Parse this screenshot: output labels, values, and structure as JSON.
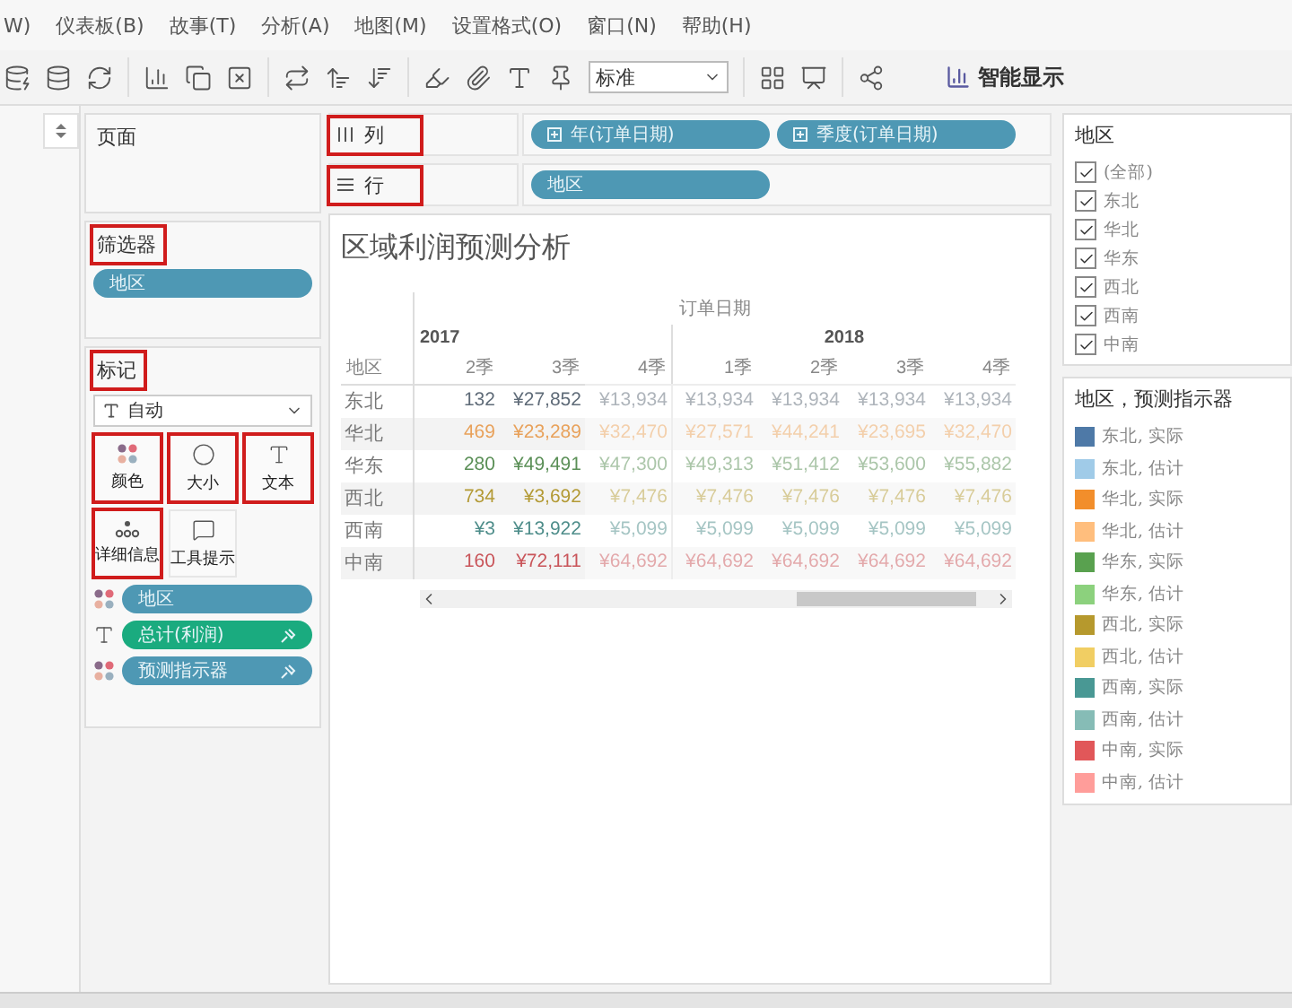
{
  "menu": [
    "W)",
    "仪表板(B)",
    "故事(T)",
    "分析(A)",
    "地图(M)",
    "设置格式(O)",
    "窗口(N)",
    "帮助(H)"
  ],
  "toolbar": {
    "select": "标准",
    "smart_button": "智能显示"
  },
  "pages": {
    "label": "页面"
  },
  "columns_shelf": {
    "label": "列",
    "highlighted": true,
    "pills": [
      "年(订单日期)",
      "季度(订单日期)"
    ]
  },
  "rows_shelf": {
    "label": "行",
    "highlighted": true,
    "pills": [
      "地区"
    ]
  },
  "filters": {
    "label": "筛选器",
    "highlighted": true,
    "pills": [
      "地区"
    ]
  },
  "marks": {
    "label": "标记",
    "highlighted": true,
    "type": "自动",
    "buttons": [
      {
        "kind": "color",
        "label": "颜色",
        "highlighted": true
      },
      {
        "kind": "size",
        "label": "大小",
        "highlighted": true
      },
      {
        "kind": "text",
        "label": "文本",
        "highlighted": true
      },
      {
        "kind": "detail",
        "label": "详细信息",
        "highlighted": true
      },
      {
        "kind": "tooltip",
        "label": "工具提示",
        "highlighted": false
      }
    ],
    "pills": [
      {
        "kind": "color",
        "label": "地区",
        "color": "#4e98b4"
      },
      {
        "kind": "text",
        "label": "总计(利润)",
        "color": "#1aab7f"
      },
      {
        "kind": "color",
        "label": "预测指示器",
        "color": "#4e98b4"
      }
    ]
  },
  "view": {
    "title": "区域利润预测分析",
    "column_header": "订单日期",
    "row_header": "地区",
    "years": [
      {
        "label": "2017",
        "quarters": [
          "2季",
          "3季",
          "4季"
        ]
      },
      {
        "label": "2018",
        "quarters": [
          "1季",
          "2季",
          "3季",
          "4季"
        ]
      }
    ],
    "rows": [
      {
        "label": "东北",
        "color": "#5f6b78",
        "cells": [
          {
            "text": "132",
            "estimate": false
          },
          {
            "text": "¥27,852",
            "estimate": false
          },
          {
            "text": "¥13,934",
            "estimate": true
          },
          {
            "text": "¥13,934",
            "estimate": true
          },
          {
            "text": "¥13,934",
            "estimate": true
          },
          {
            "text": "¥13,934",
            "estimate": true
          },
          {
            "text": "¥13,934",
            "estimate": true
          }
        ]
      },
      {
        "label": "华北",
        "color": "#e8a15a",
        "cells": [
          {
            "text": "469",
            "estimate": false
          },
          {
            "text": "¥23,289",
            "estimate": false
          },
          {
            "text": "¥32,470",
            "estimate": true
          },
          {
            "text": "¥27,571",
            "estimate": true
          },
          {
            "text": "¥44,241",
            "estimate": true
          },
          {
            "text": "¥23,695",
            "estimate": true
          },
          {
            "text": "¥32,470",
            "estimate": true
          }
        ]
      },
      {
        "label": "华东",
        "color": "#5a8f56",
        "cells": [
          {
            "text": "280",
            "estimate": false
          },
          {
            "text": "¥49,491",
            "estimate": false
          },
          {
            "text": "¥47,300",
            "estimate": true
          },
          {
            "text": "¥49,313",
            "estimate": true
          },
          {
            "text": "¥51,412",
            "estimate": true
          },
          {
            "text": "¥53,600",
            "estimate": true
          },
          {
            "text": "¥55,882",
            "estimate": true
          }
        ]
      },
      {
        "label": "西北",
        "color": "#b39a35",
        "cells": [
          {
            "text": "734",
            "estimate": false
          },
          {
            "text": "¥3,692",
            "estimate": false
          },
          {
            "text": "¥7,476",
            "estimate": true
          },
          {
            "text": "¥7,476",
            "estimate": true
          },
          {
            "text": "¥7,476",
            "estimate": true
          },
          {
            "text": "¥7,476",
            "estimate": true
          },
          {
            "text": "¥7,476",
            "estimate": true
          }
        ]
      },
      {
        "label": "西南",
        "color": "#4e8d8a",
        "cells": [
          {
            "text": "¥3",
            "estimate": false
          },
          {
            "text": "¥13,922",
            "estimate": false
          },
          {
            "text": "¥5,099",
            "estimate": true
          },
          {
            "text": "¥5,099",
            "estimate": true
          },
          {
            "text": "¥5,099",
            "estimate": true
          },
          {
            "text": "¥5,099",
            "estimate": true
          },
          {
            "text": "¥5,099",
            "estimate": true
          }
        ]
      },
      {
        "label": "中南",
        "color": "#c9555a",
        "cells": [
          {
            "text": "160",
            "estimate": false
          },
          {
            "text": "¥72,111",
            "estimate": false
          },
          {
            "text": "¥64,692",
            "estimate": true
          },
          {
            "text": "¥64,692",
            "estimate": true
          },
          {
            "text": "¥64,692",
            "estimate": true
          },
          {
            "text": "¥64,692",
            "estimate": true
          },
          {
            "text": "¥64,692",
            "estimate": true
          }
        ]
      }
    ]
  },
  "filter_card": {
    "title": "地区",
    "items": [
      {
        "label": "(全部)",
        "checked": true
      },
      {
        "label": "东北",
        "checked": true
      },
      {
        "label": "华北",
        "checked": true
      },
      {
        "label": "华东",
        "checked": true
      },
      {
        "label": "西北",
        "checked": true
      },
      {
        "label": "西南",
        "checked": true
      },
      {
        "label": "中南",
        "checked": true
      }
    ]
  },
  "legend": {
    "title": "地区，预测指示器",
    "items": [
      {
        "label": "东北, 实际",
        "color": "#4e79a7"
      },
      {
        "label": "东北, 估计",
        "color": "#a0cbe8"
      },
      {
        "label": "华北, 实际",
        "color": "#f28e2b"
      },
      {
        "label": "华北, 估计",
        "color": "#ffbe7d"
      },
      {
        "label": "华东, 实际",
        "color": "#59a14f"
      },
      {
        "label": "华东, 估计",
        "color": "#8cd17d"
      },
      {
        "label": "西北, 实际",
        "color": "#b6992d"
      },
      {
        "label": "西北, 估计",
        "color": "#f1ce63"
      },
      {
        "label": "西南, 实际",
        "color": "#499894"
      },
      {
        "label": "西南, 估计",
        "color": "#86bcb6"
      },
      {
        "label": "中南, 实际",
        "color": "#e15759"
      },
      {
        "label": "中南, 估计",
        "color": "#ff9d9a"
      }
    ]
  }
}
